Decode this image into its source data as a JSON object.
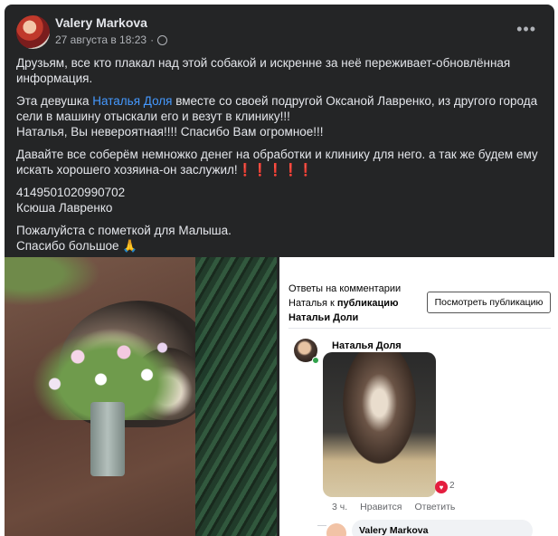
{
  "post": {
    "author": "Valery Markova",
    "date": "27 августа в 18:23",
    "dot": "·",
    "more": "•••",
    "p1": "Друзьям, все кто плакал над этой собакой и искренне за неё переживает-обновлённая информация.",
    "p2_before": "Эта девушка ",
    "p2_link": "Наталья Доля",
    "p2_after": " вместе со своей подругой Оксаной Лавренко, из другого города сели в машину отыскали его и везут в клинику!!!",
    "p2_line2": "Наталья, Вы невероятная!!!! Спасибо Вам огромное!!!",
    "p3": "Давайте все соберём немножко денег на обработки и клинику для него. а так же будем ему искать хорошего хозяина-он заслужил!",
    "p3_bangs": "❗❗❗❗❗",
    "card_number": "4149501020990702",
    "card_name": "Ксюша Лавренко",
    "p4_line1": "Пожалуйста с пометкой для Малыша.",
    "p4_line2": "Спасибо большое 🙏"
  },
  "screenshot": {
    "title_line1": "Ответы на комментарии",
    "title_line2_prefix": "Наталья к ",
    "title_line2_bold": "публикацию",
    "title_line3": "Натальи Доли",
    "button": "Посмотреть публикацию",
    "commenter": "Наталья Доля",
    "reaction_count": "2",
    "time": "3 ч.",
    "like": "Нравится",
    "reply": "Ответить",
    "bottom_author": "Valery Markova"
  }
}
